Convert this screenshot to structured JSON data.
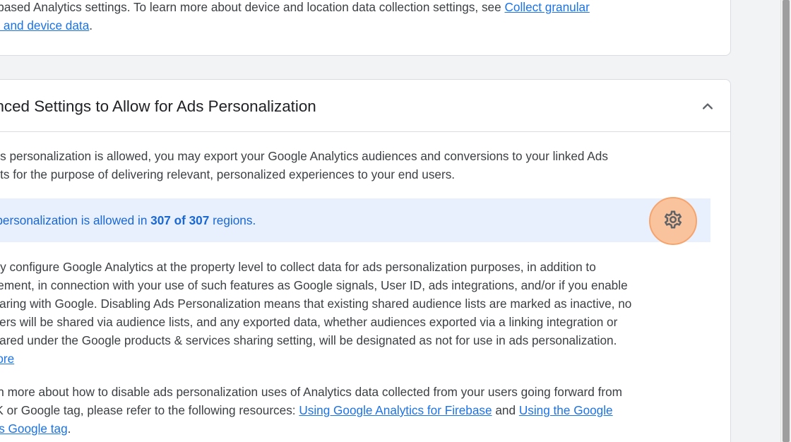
{
  "top_card": {
    "line1": "n-based Analytics settings. To learn more about device and location data collection settings, see ",
    "line1_link": "Collect granular",
    "line2_link": "on and device data",
    "line2_tail": "."
  },
  "ads_section": {
    "title": "anced Settings to Allow for Ads Personalization",
    "chevron_icon": "chevron-up-icon",
    "intro": [
      " ads personalization is allowed, you may export your Google Analytics audiences and conversions to your linked Ads",
      "unts for the purpose of delivering relevant, personalized experiences to your end users."
    ],
    "banner": {
      "prefix": "s personalization is allowed in ",
      "count": "307 of 307",
      "suffix": " regions.",
      "gear_icon": "gear-icon"
    },
    "body": [
      "nay configure Google Analytics at the property level to collect data for ads personalization purposes, in addition to",
      "urement, in connection with your use of such features as Google signals, User ID, ads integrations, and/or if you enable",
      "sharing with Google. Disabling Ads Personalization means that existing shared audience lists are marked as inactive, no",
      "users will be shared via audience lists, and any exported data, whether audiences exported via a linking integration or",
      "shared under the Google products & services sharing setting, will be designated as not for use in ads personalization."
    ],
    "learn_more": " more",
    "resources": {
      "line1": "arn more about how to disable ads personalization uses of Analytics data collected from your users going forward from",
      "line2_prefix": "DK or Google tag, please refer to the following resources: ",
      "link1": "Using Google Analytics for Firebase",
      "and": " and ",
      "link2": "Using the Google",
      "line3_link": "tics Google tag",
      "line3_tail": "."
    }
  },
  "colors": {
    "link": "#1a73e8",
    "banner_bg": "#e8f0fe",
    "banner_text": "#1967d2",
    "highlight": "#f6a46c"
  }
}
